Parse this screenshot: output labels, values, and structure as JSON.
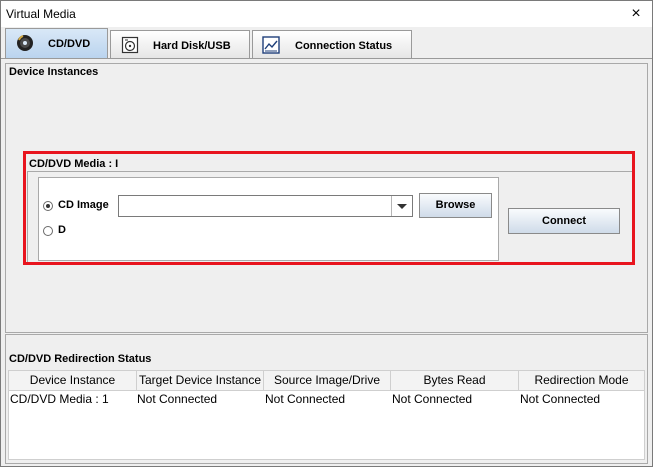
{
  "window": {
    "title": "Virtual Media",
    "close_glyph": "×"
  },
  "tabs": [
    {
      "label": "CD/DVD",
      "icon": "cd-dvd-icon",
      "active": true
    },
    {
      "label": "Hard Disk/USB",
      "icon": "hard-disk-icon",
      "active": false
    },
    {
      "label": "Connection Status",
      "icon": "chart-icon",
      "active": false
    }
  ],
  "device_instances": {
    "title": "Device Instances",
    "media_group_title": "CD/DVD Media : I",
    "radio_cd_image_label": "CD Image",
    "radio_cd_image_selected": true,
    "radio_d_label": "D",
    "radio_d_selected": false,
    "image_path_value": "",
    "browse_label": "Browse",
    "connect_label": "Connect"
  },
  "redirection_status": {
    "title": "CD/DVD Redirection Status",
    "columns": [
      "Device Instance",
      "Target Device Instance",
      "Source Image/Drive",
      "Bytes Read",
      "Redirection Mode"
    ],
    "rows": [
      [
        "CD/DVD Media : 1",
        "Not Connected",
        "Not Connected",
        "Not Connected",
        "Not Connected"
      ]
    ]
  },
  "colors": {
    "highlight": "#e8141e",
    "active_tab": "#c3daf2"
  }
}
